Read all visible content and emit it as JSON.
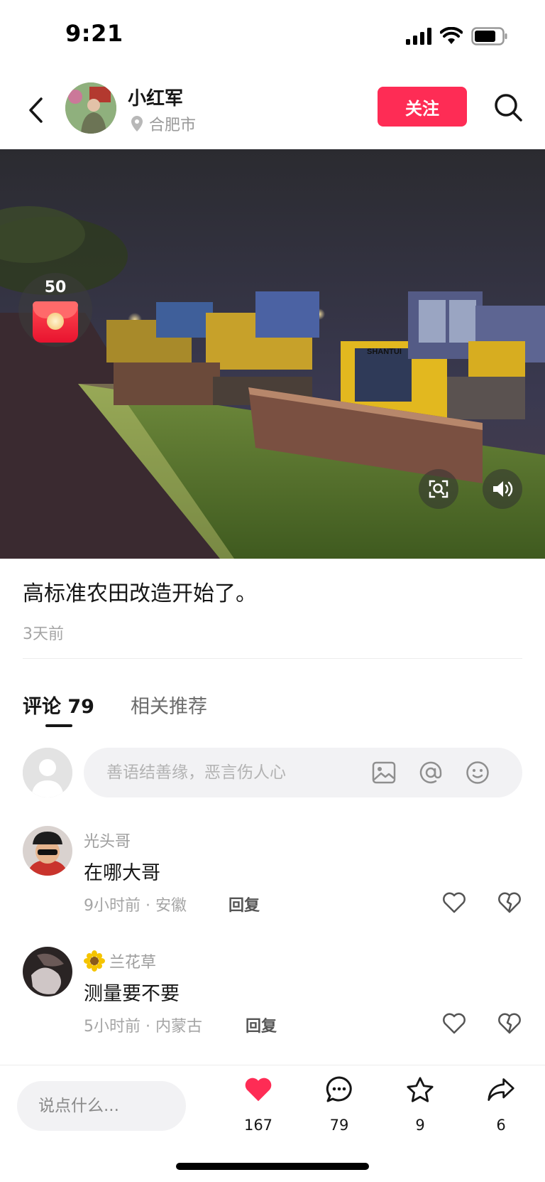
{
  "status_bar": {
    "time": "9:21"
  },
  "author": {
    "name": "小红军",
    "location": "合肥市",
    "follow_label": "关注"
  },
  "media": {
    "red_packet_count": "50"
  },
  "post": {
    "caption": "高标准农田改造开始了。",
    "time_ago": "3天前"
  },
  "tabs": [
    {
      "label": "评论 79"
    },
    {
      "label": "相关推荐"
    }
  ],
  "comment_input": {
    "placeholder": "善语结善缘，恶言伤人心"
  },
  "comments": [
    {
      "user": "光头哥",
      "text": "在哪大哥",
      "meta": "9小时前 · 安徽",
      "reply_label": "回复"
    },
    {
      "user": "兰花草",
      "text": "测量要不要",
      "meta": "5小时前 · 内蒙古",
      "reply_label": "回复"
    }
  ],
  "bottom_bar": {
    "input_placeholder": "说点什么...",
    "likes": "167",
    "comments": "79",
    "favorites": "9",
    "shares": "6"
  },
  "colors": {
    "accent": "#fe2c55",
    "like_active": "#fe2c55"
  },
  "icons": [
    "back-icon",
    "location-pin-icon",
    "search-icon",
    "red-packet-icon",
    "scan-icon",
    "volume-icon",
    "image-icon",
    "at-icon",
    "emoji-icon",
    "heart-icon",
    "broken-heart-icon",
    "comment-icon",
    "star-icon",
    "share-icon"
  ]
}
